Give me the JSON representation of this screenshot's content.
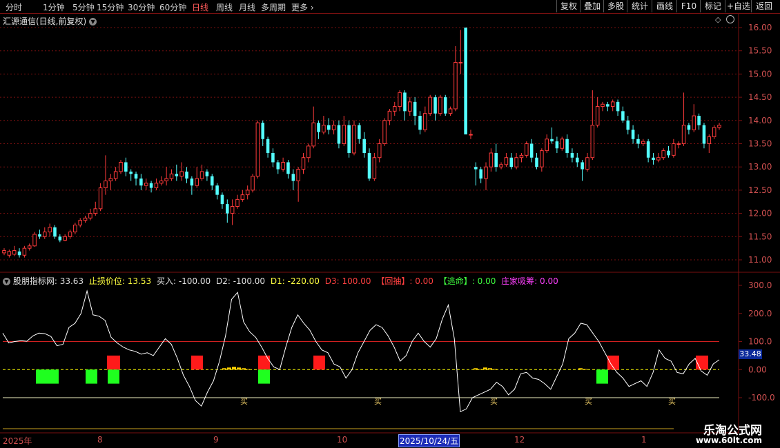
{
  "toolbar": {
    "items": [
      "分时",
      "1分钟",
      "5分钟",
      "15分钟",
      "30分钟",
      "60分钟",
      "日线",
      "周线",
      "月线",
      "多周期",
      "更多"
    ],
    "active": "日线",
    "right_buttons": [
      "复权",
      "叠加",
      "多股",
      "统计",
      "画线",
      "F10",
      "标记",
      "+自选",
      "返回"
    ]
  },
  "stock": {
    "title": "汇源通信(日线,前复权)"
  },
  "price_axis": [
    "16.00",
    "15.50",
    "15.00",
    "14.50",
    "14.00",
    "13.50",
    "13.00",
    "12.50",
    "12.00",
    "11.50",
    "11.00"
  ],
  "indicator": {
    "name": "股朋指标网",
    "value": ": 33.63",
    "stop_label": "止损价位",
    "stop_value": ": 13.53",
    "buy_label": "买入",
    "buy_value": ": -100.00",
    "d2_label": "D2",
    "d2_value": ": -100.00",
    "d1_label": "D1",
    "d1_value": ": -220.00",
    "d3_label": "D3",
    "d3_value": ": 100.00",
    "pullback_label": "【回抽】",
    "pullback_value": ": 0.00",
    "escape_label": "【逃命】",
    "escape_value": ": 0.00",
    "absorb_label": "庄家吸筹",
    "absorb_value": ": 0.00",
    "axis": [
      "300.0",
      "200.0",
      "100.0",
      "0.00",
      "-100.0"
    ],
    "current_value_box": "33.48",
    "buy_marker": "买"
  },
  "date_axis": {
    "labels": [
      "2025年",
      "8",
      "9",
      "10",
      "12",
      "1"
    ],
    "selected": "2025/10/24/五"
  },
  "watermark": {
    "line1": "乐淘公式网",
    "line2": "www.60lt.com"
  },
  "colors": {
    "up": "#ff3b3b",
    "down": "#54ffff",
    "grid": "#7a1010",
    "line": "#ffffff",
    "yellow": "#ffff00"
  },
  "chart_data": {
    "type": "candlestick",
    "ylim": [
      10.85,
      16.1
    ],
    "candles": [
      [
        11.15,
        11.2,
        11.1,
        11.25
      ],
      [
        11.1,
        11.18,
        11.05,
        11.22
      ],
      [
        11.12,
        11.2,
        11.08,
        11.3
      ],
      [
        11.18,
        11.1,
        11.05,
        11.25
      ],
      [
        11.1,
        11.25,
        11.05,
        11.3
      ],
      [
        11.25,
        11.3,
        11.2,
        11.35
      ],
      [
        11.3,
        11.55,
        11.28,
        11.6
      ],
      [
        11.55,
        11.5,
        11.45,
        11.65
      ],
      [
        11.5,
        11.6,
        11.45,
        11.7
      ],
      [
        11.6,
        11.7,
        11.5,
        11.78
      ],
      [
        11.7,
        11.5,
        11.45,
        11.75
      ],
      [
        11.5,
        11.42,
        11.38,
        11.55
      ],
      [
        11.42,
        11.5,
        11.4,
        11.55
      ],
      [
        11.5,
        11.6,
        11.45,
        11.65
      ],
      [
        11.6,
        11.75,
        11.55,
        11.8
      ],
      [
        11.75,
        11.85,
        11.7,
        11.9
      ],
      [
        11.85,
        11.9,
        11.8,
        11.95
      ],
      [
        11.9,
        12.0,
        11.85,
        12.1
      ],
      [
        12.0,
        12.1,
        11.95,
        12.25
      ],
      [
        12.1,
        12.55,
        12.05,
        12.65
      ],
      [
        12.55,
        12.7,
        12.4,
        13.25
      ],
      [
        12.7,
        12.75,
        12.5,
        12.85
      ],
      [
        12.75,
        12.9,
        12.7,
        13.0
      ],
      [
        12.9,
        13.1,
        12.85,
        13.15
      ],
      [
        13.1,
        12.9,
        12.8,
        13.2
      ],
      [
        12.9,
        12.85,
        12.7,
        12.95
      ],
      [
        12.85,
        12.75,
        12.6,
        12.9
      ],
      [
        12.75,
        12.6,
        12.5,
        12.85
      ],
      [
        12.6,
        12.65,
        12.5,
        12.75
      ],
      [
        12.65,
        12.55,
        12.45,
        12.7
      ],
      [
        12.55,
        12.65,
        12.5,
        12.75
      ],
      [
        12.65,
        12.7,
        12.6,
        12.8
      ],
      [
        12.7,
        12.75,
        12.6,
        13.0
      ],
      [
        12.75,
        12.85,
        12.7,
        12.95
      ],
      [
        12.85,
        12.8,
        12.7,
        13.05
      ],
      [
        12.8,
        12.9,
        12.7,
        13.1
      ],
      [
        12.9,
        12.75,
        12.65,
        13.0
      ],
      [
        12.75,
        12.6,
        12.4,
        12.8
      ],
      [
        12.6,
        12.75,
        12.55,
        13.0
      ],
      [
        12.75,
        12.9,
        12.7,
        13.05
      ],
      [
        12.9,
        12.8,
        12.7,
        12.95
      ],
      [
        12.8,
        12.6,
        12.5,
        12.85
      ],
      [
        12.6,
        12.4,
        12.3,
        12.65
      ],
      [
        12.4,
        12.2,
        12.1,
        12.45
      ],
      [
        12.2,
        12.0,
        11.8,
        12.3
      ],
      [
        12.0,
        12.15,
        11.75,
        12.3
      ],
      [
        12.15,
        12.3,
        12.1,
        12.4
      ],
      [
        12.3,
        12.4,
        12.25,
        12.5
      ],
      [
        12.4,
        12.5,
        12.3,
        12.6
      ],
      [
        12.5,
        12.8,
        12.45,
        12.85
      ],
      [
        12.8,
        13.95,
        12.75,
        14.0
      ],
      [
        13.95,
        13.6,
        13.45,
        14.0
      ],
      [
        13.6,
        13.3,
        13.2,
        13.65
      ],
      [
        13.3,
        13.1,
        13.0,
        13.4
      ],
      [
        13.1,
        12.95,
        12.85,
        13.15
      ],
      [
        12.95,
        13.1,
        12.9,
        13.2
      ],
      [
        13.1,
        12.85,
        12.75,
        13.15
      ],
      [
        12.85,
        12.7,
        12.5,
        12.95
      ],
      [
        12.7,
        12.95,
        12.25,
        13.0
      ],
      [
        12.95,
        13.2,
        12.85,
        13.3
      ],
      [
        13.2,
        13.45,
        13.1,
        13.5
      ],
      [
        13.45,
        13.95,
        13.4,
        14.3
      ],
      [
        13.95,
        13.75,
        13.6,
        14.0
      ],
      [
        13.75,
        13.9,
        13.7,
        14.1
      ],
      [
        13.9,
        13.8,
        13.7,
        14.05
      ],
      [
        13.8,
        13.9,
        13.7,
        14.0
      ],
      [
        13.9,
        13.5,
        13.4,
        14.0
      ],
      [
        13.5,
        13.9,
        13.45,
        14.1
      ],
      [
        13.9,
        13.3,
        13.2,
        14.0
      ],
      [
        13.3,
        13.9,
        13.25,
        14.0
      ],
      [
        13.9,
        13.6,
        13.5,
        13.95
      ],
      [
        13.6,
        13.3,
        13.2,
        13.75
      ],
      [
        13.3,
        12.75,
        12.7,
        13.4
      ],
      [
        12.75,
        13.2,
        12.7,
        13.3
      ],
      [
        13.2,
        13.5,
        13.1,
        13.6
      ],
      [
        13.5,
        14.0,
        13.45,
        14.05
      ],
      [
        14.0,
        14.2,
        13.9,
        14.25
      ],
      [
        14.2,
        14.3,
        14.1,
        14.4
      ],
      [
        14.3,
        14.6,
        14.2,
        14.65
      ],
      [
        14.6,
        14.2,
        14.0,
        14.65
      ],
      [
        14.2,
        14.4,
        14.1,
        14.5
      ],
      [
        14.4,
        14.1,
        13.9,
        14.5
      ],
      [
        14.1,
        13.8,
        13.7,
        14.2
      ],
      [
        13.8,
        14.15,
        13.75,
        14.3
      ],
      [
        14.15,
        14.5,
        14.1,
        14.55
      ],
      [
        14.5,
        14.15,
        14.0,
        14.55
      ],
      [
        14.15,
        14.5,
        14.1,
        14.55
      ],
      [
        14.5,
        14.15,
        14.1,
        14.55
      ],
      [
        14.15,
        14.25,
        14.1,
        14.3
      ],
      [
        14.25,
        15.25,
        14.2,
        15.6
      ],
      [
        15.25,
        15.25,
        15.0,
        15.95
      ],
      [
        16.0,
        13.7,
        13.7,
        16.0
      ],
      [
        13.7,
        13.7,
        13.6,
        13.8
      ],
      [
        13.0,
        12.95,
        12.6,
        13.1
      ],
      [
        12.95,
        12.75,
        12.65,
        13.0
      ],
      [
        12.75,
        13.0,
        12.5,
        13.1
      ],
      [
        13.0,
        13.3,
        12.9,
        13.4
      ],
      [
        13.3,
        13.0,
        12.9,
        13.5
      ],
      [
        13.0,
        13.05,
        12.95,
        13.1
      ],
      [
        13.05,
        13.2,
        13.0,
        13.3
      ],
      [
        13.2,
        13.0,
        12.95,
        13.3
      ],
      [
        13.0,
        13.2,
        12.95,
        13.3
      ],
      [
        13.2,
        13.25,
        13.1,
        13.3
      ],
      [
        13.25,
        13.5,
        13.2,
        13.55
      ],
      [
        13.5,
        13.2,
        13.1,
        13.6
      ],
      [
        13.2,
        13.0,
        12.95,
        13.3
      ],
      [
        13.0,
        13.35,
        12.9,
        13.4
      ],
      [
        13.35,
        13.6,
        13.3,
        13.7
      ],
      [
        13.6,
        13.55,
        13.5,
        13.85
      ],
      [
        13.55,
        13.4,
        13.3,
        13.65
      ],
      [
        13.4,
        13.6,
        13.35,
        13.65
      ],
      [
        13.6,
        13.3,
        13.2,
        13.7
      ],
      [
        13.3,
        13.2,
        13.1,
        13.4
      ],
      [
        13.2,
        13.1,
        13.0,
        13.3
      ],
      [
        13.1,
        12.95,
        12.7,
        13.15
      ],
      [
        12.95,
        13.2,
        12.9,
        13.3
      ],
      [
        13.2,
        13.9,
        13.15,
        14.65
      ],
      [
        13.9,
        14.3,
        13.85,
        14.5
      ],
      [
        14.3,
        14.35,
        14.2,
        14.4
      ],
      [
        14.35,
        14.3,
        14.2,
        14.4
      ],
      [
        14.3,
        14.4,
        14.2,
        14.45
      ],
      [
        14.4,
        14.2,
        14.1,
        14.45
      ],
      [
        14.2,
        14.0,
        13.95,
        14.3
      ],
      [
        14.0,
        13.8,
        13.7,
        14.1
      ],
      [
        13.8,
        13.6,
        13.5,
        13.9
      ],
      [
        13.6,
        13.5,
        13.4,
        13.7
      ],
      [
        13.5,
        13.55,
        13.45,
        13.6
      ],
      [
        13.55,
        13.2,
        13.1,
        13.6
      ],
      [
        13.2,
        13.15,
        13.05,
        13.3
      ],
      [
        13.15,
        13.2,
        13.1,
        13.3
      ],
      [
        13.2,
        13.35,
        13.15,
        13.4
      ],
      [
        13.35,
        13.25,
        13.2,
        13.45
      ],
      [
        13.25,
        13.5,
        13.2,
        13.6
      ],
      [
        13.5,
        13.5,
        13.4,
        13.55
      ],
      [
        13.5,
        13.9,
        13.45,
        14.6
      ],
      [
        13.9,
        13.8,
        13.7,
        13.95
      ],
      [
        13.8,
        14.1,
        13.75,
        14.35
      ],
      [
        14.1,
        13.9,
        13.8,
        14.15
      ],
      [
        13.9,
        13.5,
        13.4,
        13.95
      ],
      [
        13.5,
        13.65,
        13.3,
        13.7
      ],
      [
        13.65,
        13.85,
        13.6,
        13.9
      ],
      [
        13.85,
        13.9,
        13.8,
        13.95
      ]
    ],
    "indicator_series": {
      "name": "股朋指标网",
      "ylim": [
        -160,
        330
      ],
      "reference_lines": [
        100,
        0,
        -100
      ],
      "values": [
        130,
        95,
        100,
        103,
        101,
        120,
        130,
        128,
        118,
        85,
        90,
        150,
        165,
        200,
        280,
        195,
        190,
        175,
        115,
        95,
        80,
        70,
        65,
        55,
        60,
        50,
        80,
        110,
        90,
        40,
        -20,
        -60,
        -110,
        -130,
        -80,
        -40,
        30,
        120,
        250,
        275,
        170,
        135,
        115,
        80,
        40,
        10,
        0,
        80,
        150,
        195,
        165,
        140,
        100,
        70,
        60,
        20,
        10,
        -30,
        0,
        60,
        100,
        140,
        160,
        150,
        120,
        80,
        30,
        50,
        100,
        130,
        100,
        80,
        110,
        180,
        230,
        110,
        -150,
        -140,
        -100,
        -90,
        -80,
        -70,
        -45,
        -60,
        -90,
        -70,
        -15,
        -10,
        -30,
        -35,
        -50,
        -70,
        -25,
        20,
        110,
        130,
        165,
        160,
        130,
        100,
        60,
        20,
        -10,
        -30,
        -60,
        -50,
        -40,
        -60,
        -10,
        70,
        40,
        30,
        -10,
        -15,
        20,
        40,
        -5,
        -20,
        20,
        35
      ]
    }
  }
}
